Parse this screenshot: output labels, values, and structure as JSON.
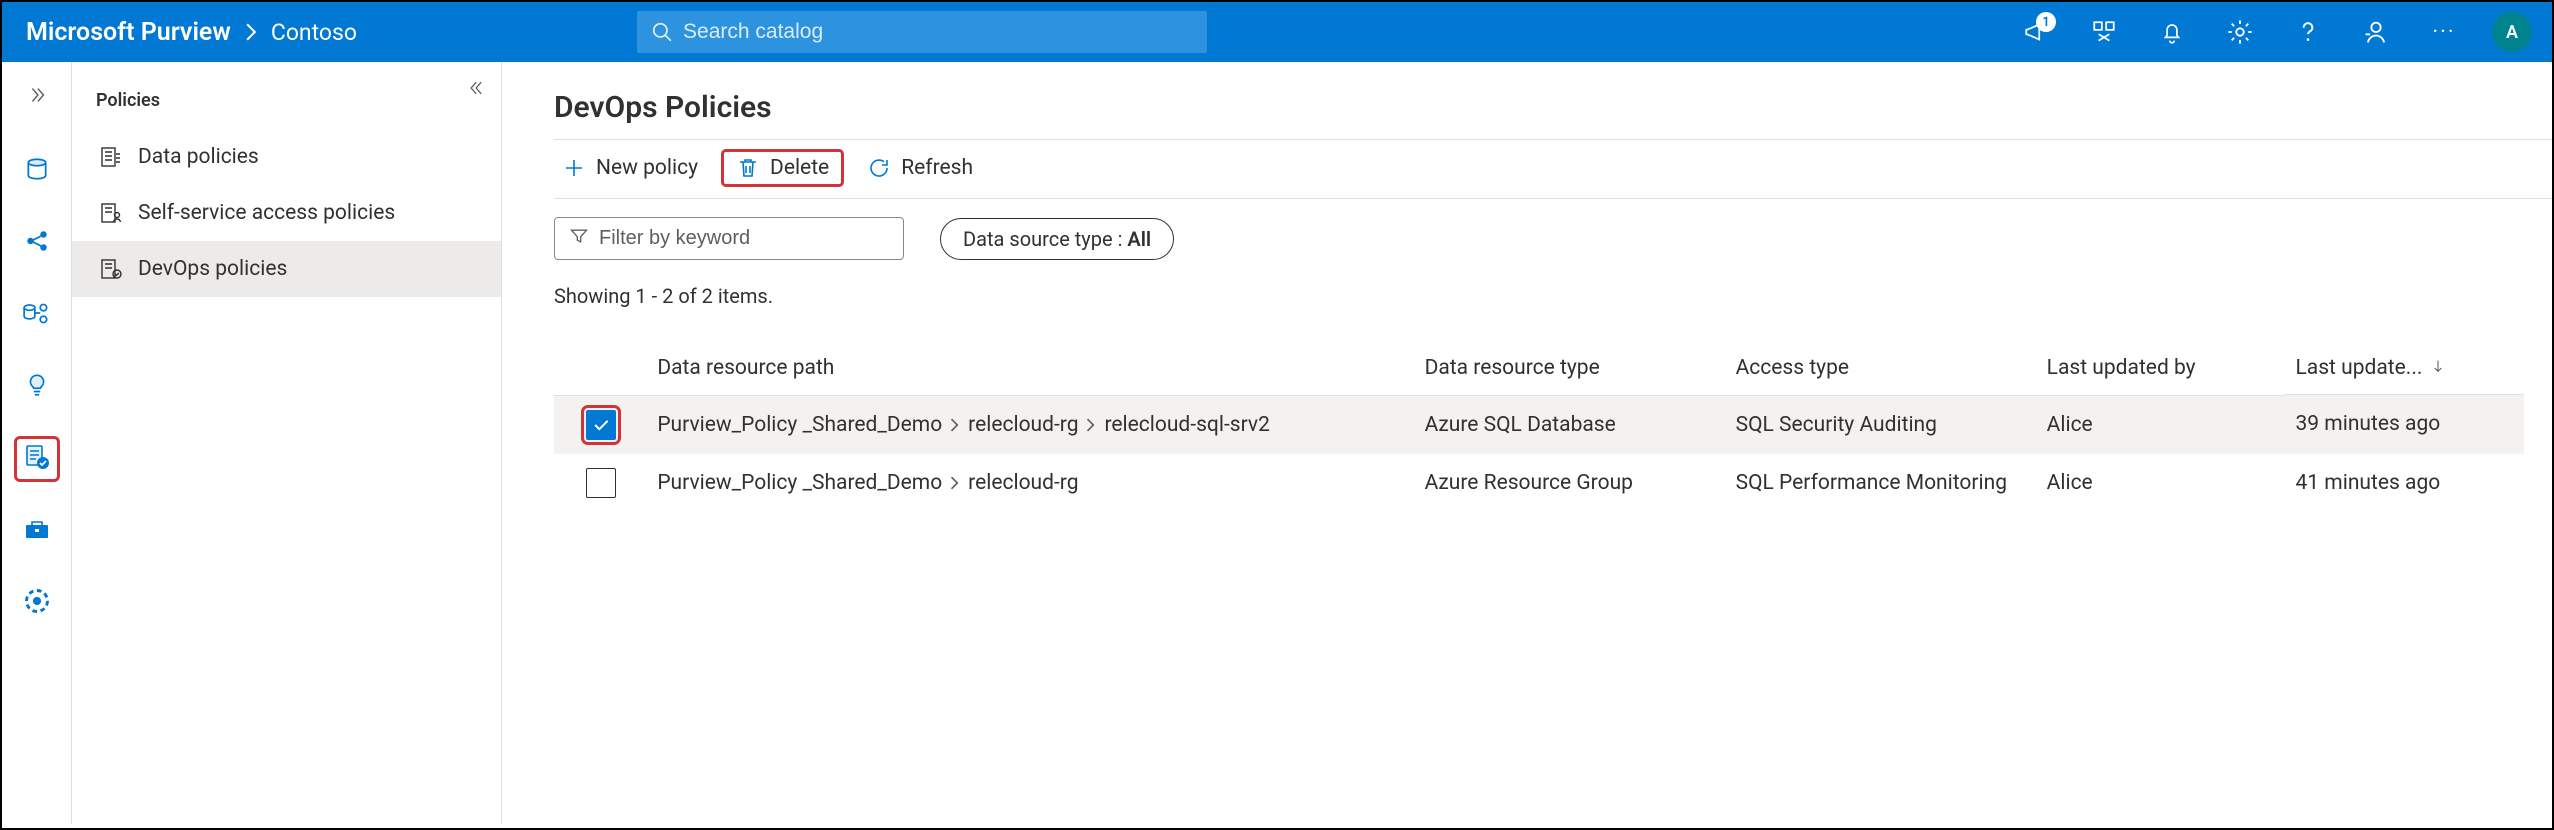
{
  "header": {
    "brand": "Microsoft Purview",
    "breadcrumb": "Contoso",
    "search_placeholder": "Search catalog",
    "badge_count": "1",
    "avatar_initial": "A"
  },
  "rail": {
    "items": [
      {
        "name": "rail-data-catalog",
        "icon": "database"
      },
      {
        "name": "rail-data-map",
        "icon": "share"
      },
      {
        "name": "rail-data-estate",
        "icon": "pipeline"
      },
      {
        "name": "rail-insights",
        "icon": "lightbulb"
      },
      {
        "name": "rail-policy",
        "icon": "policy",
        "selected": true
      },
      {
        "name": "rail-management",
        "icon": "toolbox"
      },
      {
        "name": "rail-privacy",
        "icon": "target"
      }
    ]
  },
  "subnav": {
    "title": "Policies",
    "items": [
      {
        "label": "Data policies",
        "icon": "doc-list"
      },
      {
        "label": "Self-service access policies",
        "icon": "doc-people"
      },
      {
        "label": "DevOps policies",
        "icon": "doc-check",
        "selected": true
      }
    ]
  },
  "page": {
    "title": "DevOps Policies",
    "toolbar": {
      "new_label": "New policy",
      "delete_label": "Delete",
      "refresh_label": "Refresh"
    },
    "filter": {
      "placeholder": "Filter by keyword",
      "pill_prefix": "Data source type : ",
      "pill_value": "All"
    },
    "count_text": "Showing 1 - 2 of 2 items.",
    "columns": {
      "path": "Data resource path",
      "type": "Data resource type",
      "access": "Access type",
      "by": "Last updated by",
      "at": "Last update..."
    },
    "rows": [
      {
        "checked": true,
        "highlight_cb": true,
        "selected": true,
        "path": [
          "Purview_Policy _Shared_Demo",
          "relecloud-rg",
          "relecloud-sql-srv2"
        ],
        "type": "Azure SQL Database",
        "access": "SQL Security Auditing",
        "by": "Alice",
        "at": "39 minutes ago"
      },
      {
        "checked": false,
        "path": [
          "Purview_Policy _Shared_Demo",
          "relecloud-rg"
        ],
        "type": "Azure Resource Group",
        "access": "SQL Performance Monitoring",
        "by": "Alice",
        "at": "41 minutes ago"
      }
    ]
  }
}
